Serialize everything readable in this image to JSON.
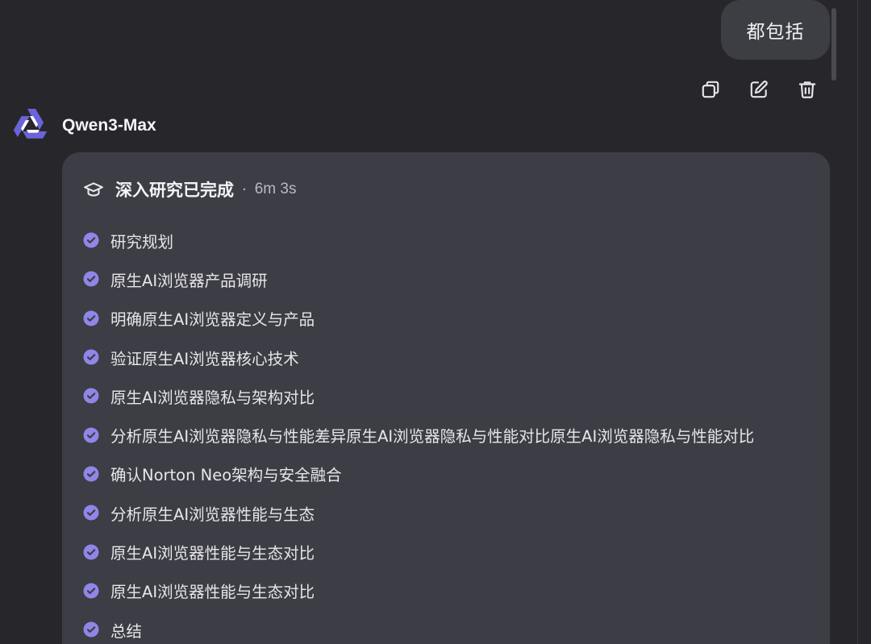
{
  "user_message": {
    "text": "都包括"
  },
  "message_actions": [
    {
      "name": "copy-icon"
    },
    {
      "name": "edit-icon"
    },
    {
      "name": "trash-icon"
    }
  ],
  "assistant": {
    "name": "Qwen3-Max",
    "logo_icon": "qwen-logo-icon",
    "logo_color": "#6b63d9"
  },
  "research": {
    "icon": "graduation-cap-icon",
    "title": "深入研究已完成",
    "separator": "·",
    "duration": "6m 3s",
    "check_color": "#8f86e8",
    "steps": [
      {
        "label": "研究规划"
      },
      {
        "label": "原生AI浏览器产品调研"
      },
      {
        "label": "明确原生AI浏览器定义与产品"
      },
      {
        "label": "验证原生AI浏览器核心技术"
      },
      {
        "label": "原生AI浏览器隐私与架构对比"
      },
      {
        "label": "分析原生AI浏览器隐私与性能差异原生AI浏览器隐私与性能对比原生AI浏览器隐私与性能对比"
      },
      {
        "label": "确认Norton Neo架构与安全融合"
      },
      {
        "label": "分析原生AI浏览器性能与生态"
      },
      {
        "label": "原生AI浏览器性能与生态对比"
      },
      {
        "label": "原生AI浏览器性能与生态对比"
      },
      {
        "label": "总结"
      }
    ]
  }
}
